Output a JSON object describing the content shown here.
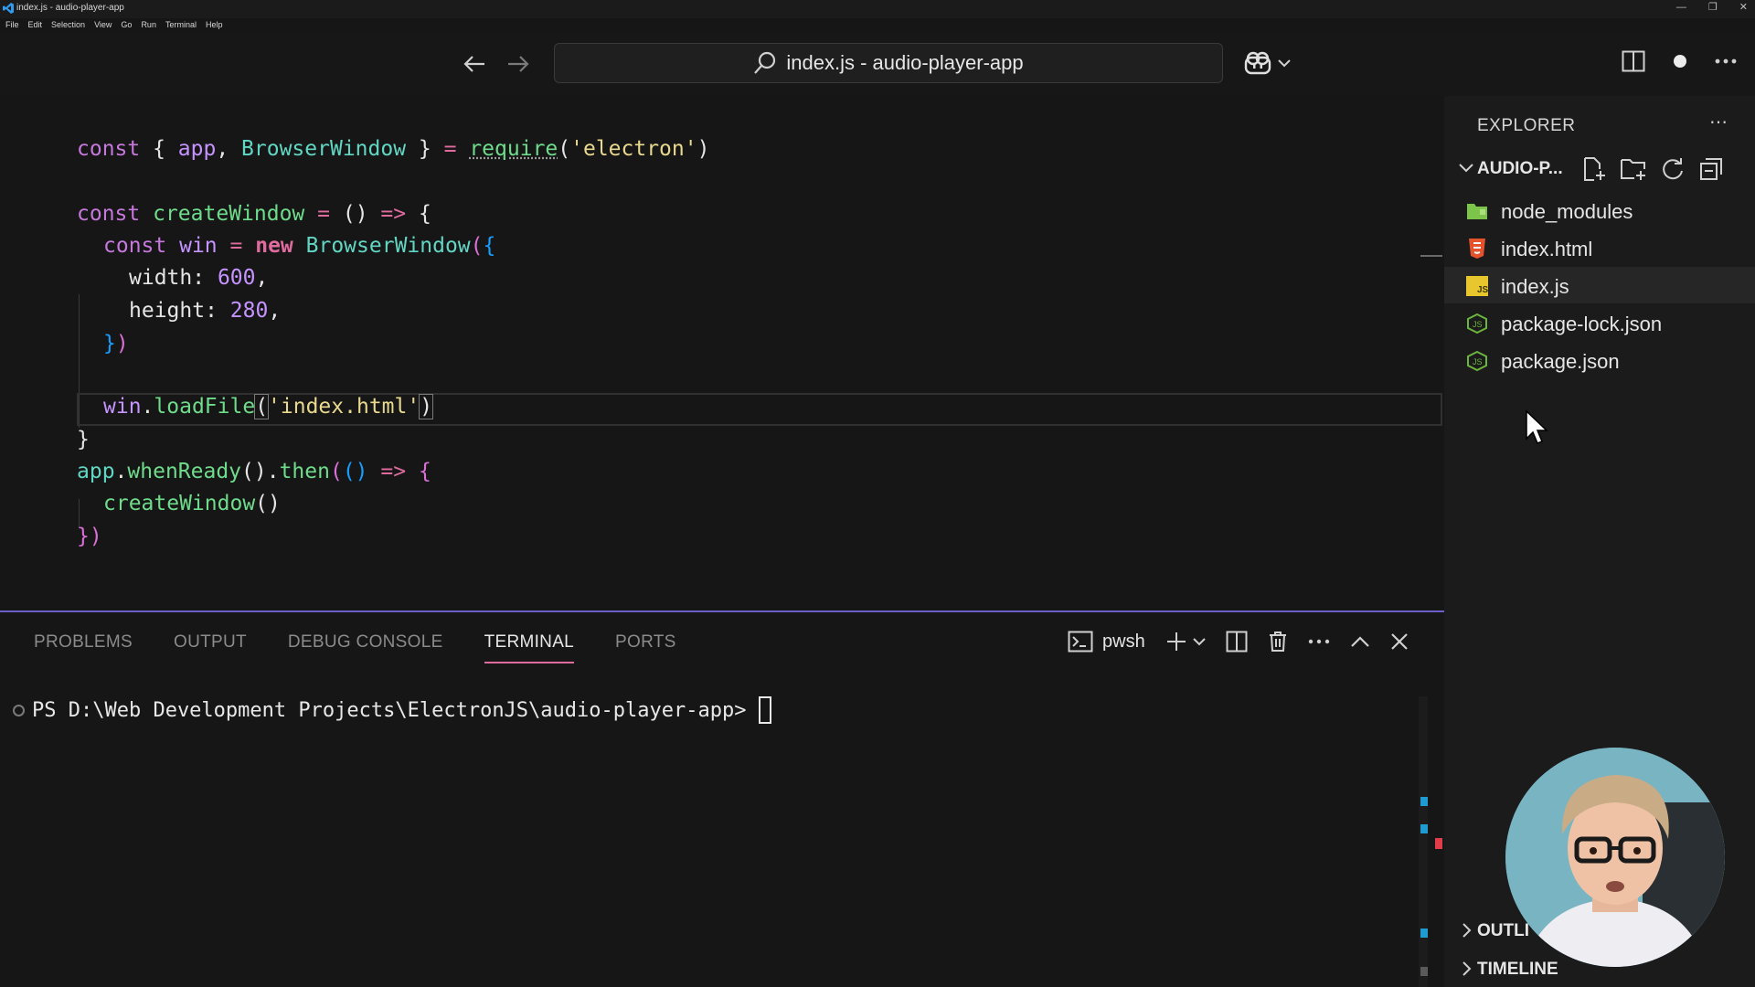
{
  "window": {
    "title": "index.js - audio-player-app",
    "menu": [
      "File",
      "Edit",
      "Selection",
      "View",
      "Go",
      "Run",
      "Terminal",
      "Help"
    ]
  },
  "command_center": {
    "search_text": "index.js - audio-player-app"
  },
  "editor": {
    "lines": {
      "l1": {
        "kw": "const",
        "a": " { ",
        "b": "app",
        "c": ", ",
        "d": "BrowserWindow",
        "e": " } ",
        "f": "=",
        "g": " ",
        "h": "require",
        "i": "(",
        "j": "'electron'",
        "k": ")"
      },
      "l2": {
        "kw": "const",
        "a": " ",
        "b": "createWindow",
        "c": " ",
        "d": "=",
        "e": " () ",
        "f": "=>",
        "g": " ",
        "h": "{"
      },
      "l3": {
        "kw": "const",
        "a": " ",
        "b": "win",
        "c": " ",
        "d": "=",
        "e": " ",
        "f": "new",
        "g": " ",
        "h": "BrowserWindow",
        "i": "(",
        "j": "{"
      },
      "l4": {
        "a": "width",
        "b": ": ",
        "c": "600",
        "d": ","
      },
      "l5": {
        "a": "height",
        "b": ": ",
        "c": "280",
        "d": ","
      },
      "l6": {
        "a": "}",
        "b": ")"
      },
      "l7": {
        "a": "win",
        "b": ".",
        "c": "loadFile",
        "d": "(",
        "e": "'index.html'",
        "f": ")"
      },
      "l8": {
        "a": "}"
      },
      "l9": {
        "a": "app",
        "b": ".",
        "c": "whenReady",
        "d": "().",
        "e": "then",
        "f": "(",
        "g": "() ",
        "h": "=>",
        "i": " ",
        "j": "{"
      },
      "l10": {
        "a": "createWindow",
        "b": "()"
      },
      "l11": {
        "a": "}",
        "b": ")"
      }
    }
  },
  "panel": {
    "tabs": [
      "PROBLEMS",
      "OUTPUT",
      "DEBUG CONSOLE",
      "TERMINAL",
      "PORTS"
    ],
    "active_tab": "TERMINAL",
    "shell_label": "pwsh",
    "terminal_prompt": "PS D:\\Web Development Projects\\ElectronJS\\audio-player-app>"
  },
  "explorer": {
    "title": "EXPLORER",
    "folder_name": "AUDIO-P...",
    "files": [
      {
        "name": "node_modules",
        "icon": "folder-icon"
      },
      {
        "name": "index.html",
        "icon": "html-icon"
      },
      {
        "name": "index.js",
        "icon": "js-icon"
      },
      {
        "name": "package-lock.json",
        "icon": "json-icon"
      },
      {
        "name": "package.json",
        "icon": "json-icon"
      }
    ],
    "selected_file": "index.js",
    "sections": [
      "OUTLI",
      "TIMELINE"
    ]
  },
  "colors": {
    "accent": "#6c5fc7",
    "active_tab_underline": "#e06c9f",
    "keyword": "#c678dd",
    "string": "#e9d98e",
    "number": "#c594ff",
    "function": "#6fdc8c"
  }
}
